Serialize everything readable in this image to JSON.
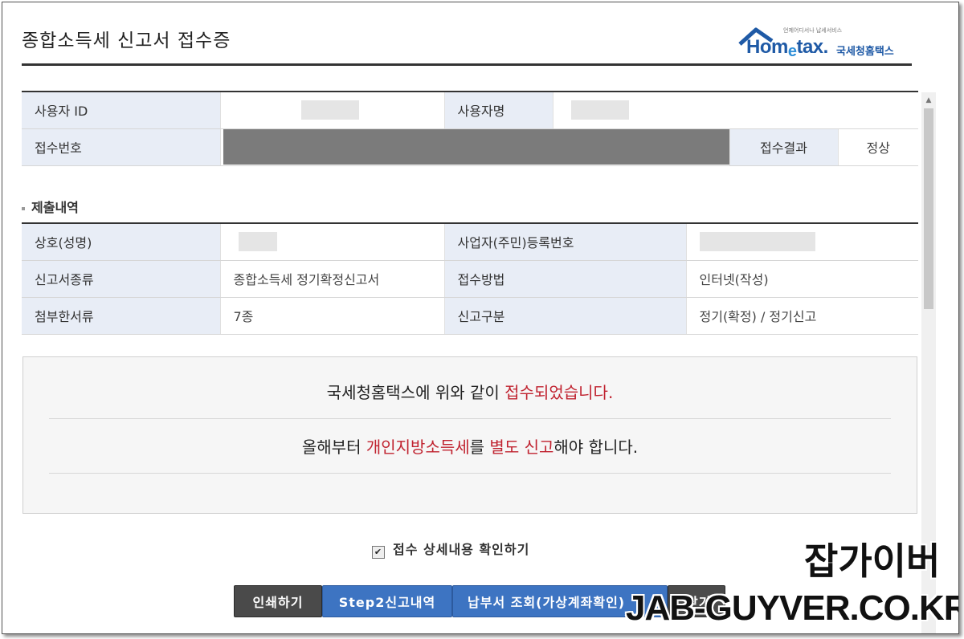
{
  "page": {
    "title": "종합소득세 신고서 접수증"
  },
  "logo": {
    "tagline": "언제어디서나 납세서비스",
    "wordmark_a": "Hom",
    "wordmark_e": "e",
    "wordmark_b": "tax.",
    "brand_kr": "국세청홈택스"
  },
  "user_info": {
    "user_id_label": "사용자 ID",
    "user_name_label": "사용자명",
    "receipt_no_label": "접수번호",
    "receipt_result_label": "접수결과",
    "receipt_result_value": "정상"
  },
  "submission": {
    "section_title": "제출내역",
    "rows": [
      {
        "label": "상호(성명)",
        "value": "",
        "label2": "사업자(주민)등록번호",
        "value2": ""
      },
      {
        "label": "신고서종류",
        "value": "종합소득세 정기확정신고서",
        "label2": "접수방법",
        "value2": "인터넷(작성)"
      },
      {
        "label": "첨부한서류",
        "value": "7종",
        "label2": "신고구분",
        "value2": "정기(확정) / 정기신고"
      }
    ]
  },
  "message": {
    "line1_a": "국세청홈택스에 위와 같이 ",
    "line1_hl": "접수되었습니다.",
    "line2_a": "올해부터 ",
    "line2_hl1": "개인지방소득세",
    "line2_b": "를 ",
    "line2_hl2": "별도 신고",
    "line2_c": "해야 합니다."
  },
  "checkbox": {
    "label": "접수 상세내용 확인하기",
    "checked_glyph": "✔"
  },
  "buttons": {
    "print": "인쇄하기",
    "step2": "Step2신고내역",
    "payment": "납부서 조회(가상계좌확인)",
    "close": "닫기"
  },
  "watermark": {
    "kr": "잡가이버",
    "en": "JAB-GUYVER.CO.KR"
  },
  "scrollbar": {
    "up_glyph": "▲"
  },
  "colors": {
    "accent_red": "#c0222f",
    "label_bg": "#e8edf6",
    "button_blue": "#3d74c2",
    "button_dark": "#4a4a4a"
  }
}
